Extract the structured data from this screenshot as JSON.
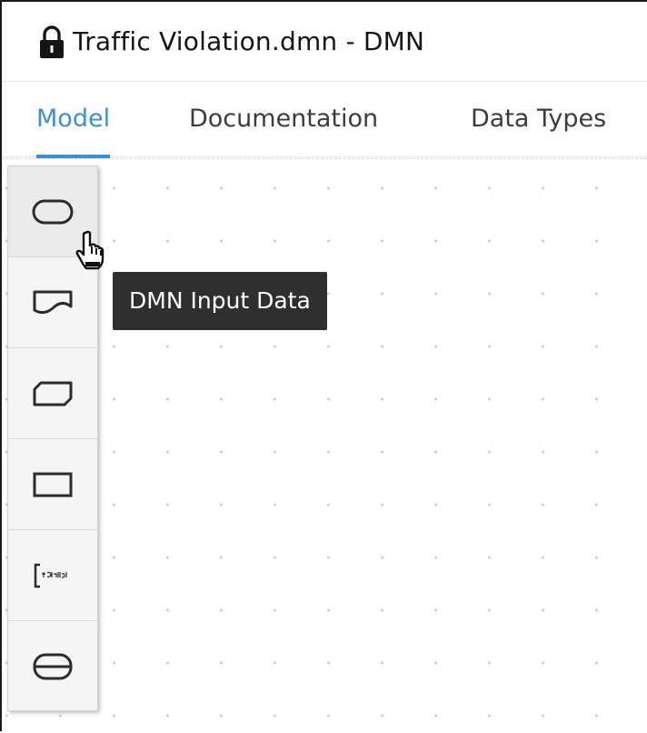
{
  "window": {
    "title": "Traffic Violation.dmn - DMN",
    "lock_icon": "lock-icon"
  },
  "tabs": [
    {
      "label": "Model",
      "active": true
    },
    {
      "label": "Documentation",
      "active": false
    },
    {
      "label": "Data Types",
      "active": false
    }
  ],
  "palette": {
    "items": [
      {
        "icon": "dmn-input-data-icon"
      },
      {
        "icon": "dmn-knowledge-source-icon"
      },
      {
        "icon": "dmn-business-knowledge-model-icon"
      },
      {
        "icon": "dmn-decision-icon"
      },
      {
        "icon": "dmn-text-annotation-icon"
      },
      {
        "icon": "dmn-decision-service-icon"
      }
    ]
  },
  "tooltip": {
    "text": "DMN Input Data"
  },
  "colors": {
    "accent": "#3b92cf",
    "tooltip_bg": "#2f2f2f",
    "palette_bg": "#f5f5f5"
  }
}
